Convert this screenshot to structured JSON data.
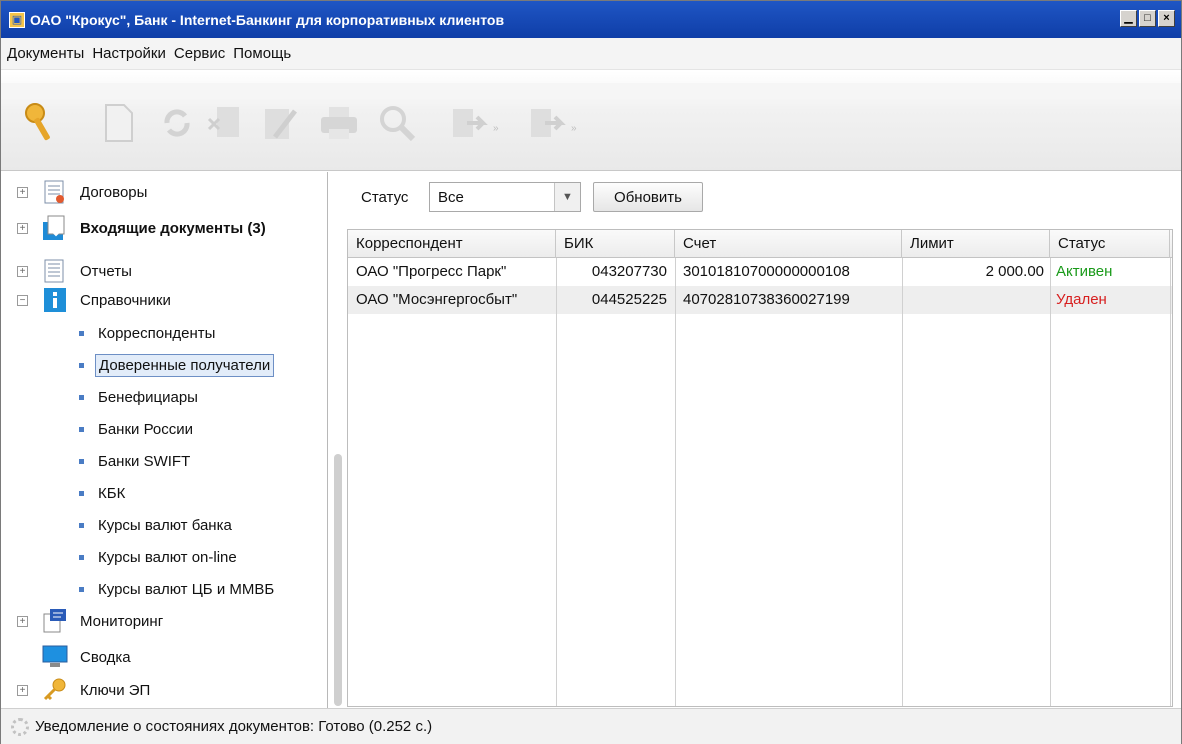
{
  "window": {
    "title": "ОАО \"Крокус\", Банк - Internet-Банкинг для корпоративных клиентов",
    "controls": [
      "minimize",
      "maximize",
      "close"
    ]
  },
  "menu": [
    "Документы",
    "Настройки",
    "Сервис",
    "Помощь"
  ],
  "toolbar": {
    "icons": [
      "key-icon",
      "new-document-icon",
      "refresh-icon",
      "delete-icon",
      "edit-icon",
      "print-icon",
      "search-icon",
      "import-icon",
      "export-icon"
    ]
  },
  "sidebar": {
    "items": [
      {
        "label": "Договоры",
        "expander": "+",
        "icon": "contracts-icon",
        "bold": false
      },
      {
        "label": "Входящие документы (3)",
        "expander": "+",
        "icon": "incoming-documents-icon",
        "bold": true
      },
      {
        "label": "Отчеты",
        "expander": "+",
        "icon": "reports-icon",
        "bold": false
      },
      {
        "label": "Справочники",
        "expander": "−",
        "icon": "info-icon",
        "bold": false
      }
    ],
    "subitems": [
      "Корреспонденты",
      "Доверенные получатели",
      "Бенефициары",
      "Банки России",
      "Банки SWIFT",
      "КБК",
      "Курсы валют банка",
      "Курсы валют on-line",
      "Курсы валют ЦБ и ММВБ"
    ],
    "selected_subitem": "Доверенные получатели",
    "bottom_items": [
      {
        "label": "Мониторинг",
        "expander": "+",
        "icon": "monitoring-icon"
      },
      {
        "label": "Сводка",
        "expander": "",
        "icon": "monitor-icon"
      },
      {
        "label": "Ключи ЭП",
        "expander": "+",
        "icon": "key-icon"
      }
    ]
  },
  "filter": {
    "label": "Статус",
    "value": "Все",
    "refresh_button": "Обновить"
  },
  "table": {
    "columns": [
      "Корреспондент",
      "БИК",
      "Счет",
      "Лимит",
      "Статус"
    ],
    "rows": [
      [
        "ОАО \"Прогресс Парк\"",
        "043207730",
        "30101810700000000108",
        "2 000.00",
        "Активен"
      ],
      [
        "ОАО \"Мосэнгергосбыт\"",
        "044525225",
        "40702810738360027199",
        "",
        "Удален"
      ]
    ],
    "status_colors": {
      "Активен": "#1a9a1a",
      "Удален": "#d71f1f"
    }
  },
  "statusbar": {
    "text": "Уведомление о состояниях документов: Готово (0.252 с.)"
  }
}
